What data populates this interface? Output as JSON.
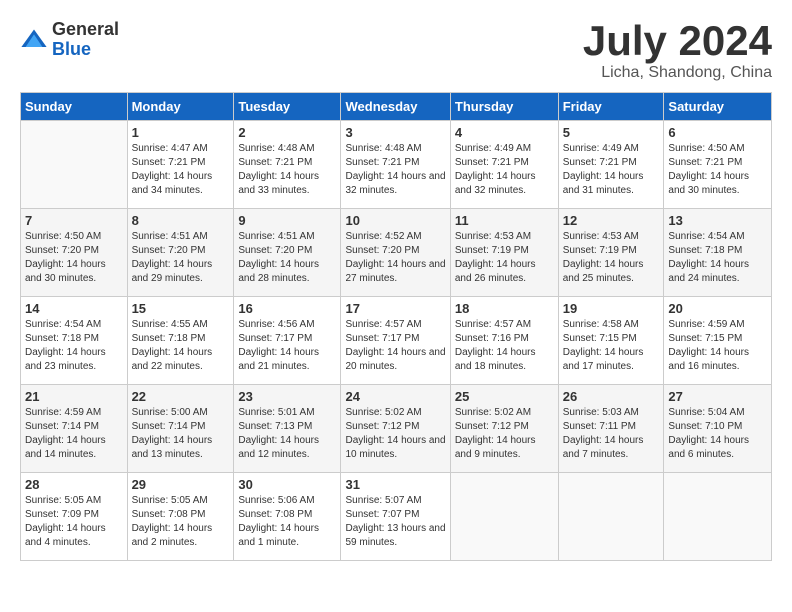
{
  "logo": {
    "general": "General",
    "blue": "Blue"
  },
  "title": "July 2024",
  "subtitle": "Licha, Shandong, China",
  "headers": [
    "Sunday",
    "Monday",
    "Tuesday",
    "Wednesday",
    "Thursday",
    "Friday",
    "Saturday"
  ],
  "weeks": [
    [
      {
        "day": "",
        "sunrise": "",
        "sunset": "",
        "daylight": ""
      },
      {
        "day": "1",
        "sunrise": "Sunrise: 4:47 AM",
        "sunset": "Sunset: 7:21 PM",
        "daylight": "Daylight: 14 hours and 34 minutes."
      },
      {
        "day": "2",
        "sunrise": "Sunrise: 4:48 AM",
        "sunset": "Sunset: 7:21 PM",
        "daylight": "Daylight: 14 hours and 33 minutes."
      },
      {
        "day": "3",
        "sunrise": "Sunrise: 4:48 AM",
        "sunset": "Sunset: 7:21 PM",
        "daylight": "Daylight: 14 hours and 32 minutes."
      },
      {
        "day": "4",
        "sunrise": "Sunrise: 4:49 AM",
        "sunset": "Sunset: 7:21 PM",
        "daylight": "Daylight: 14 hours and 32 minutes."
      },
      {
        "day": "5",
        "sunrise": "Sunrise: 4:49 AM",
        "sunset": "Sunset: 7:21 PM",
        "daylight": "Daylight: 14 hours and 31 minutes."
      },
      {
        "day": "6",
        "sunrise": "Sunrise: 4:50 AM",
        "sunset": "Sunset: 7:21 PM",
        "daylight": "Daylight: 14 hours and 30 minutes."
      }
    ],
    [
      {
        "day": "7",
        "sunrise": "Sunrise: 4:50 AM",
        "sunset": "Sunset: 7:20 PM",
        "daylight": "Daylight: 14 hours and 30 minutes."
      },
      {
        "day": "8",
        "sunrise": "Sunrise: 4:51 AM",
        "sunset": "Sunset: 7:20 PM",
        "daylight": "Daylight: 14 hours and 29 minutes."
      },
      {
        "day": "9",
        "sunrise": "Sunrise: 4:51 AM",
        "sunset": "Sunset: 7:20 PM",
        "daylight": "Daylight: 14 hours and 28 minutes."
      },
      {
        "day": "10",
        "sunrise": "Sunrise: 4:52 AM",
        "sunset": "Sunset: 7:20 PM",
        "daylight": "Daylight: 14 hours and 27 minutes."
      },
      {
        "day": "11",
        "sunrise": "Sunrise: 4:53 AM",
        "sunset": "Sunset: 7:19 PM",
        "daylight": "Daylight: 14 hours and 26 minutes."
      },
      {
        "day": "12",
        "sunrise": "Sunrise: 4:53 AM",
        "sunset": "Sunset: 7:19 PM",
        "daylight": "Daylight: 14 hours and 25 minutes."
      },
      {
        "day": "13",
        "sunrise": "Sunrise: 4:54 AM",
        "sunset": "Sunset: 7:18 PM",
        "daylight": "Daylight: 14 hours and 24 minutes."
      }
    ],
    [
      {
        "day": "14",
        "sunrise": "Sunrise: 4:54 AM",
        "sunset": "Sunset: 7:18 PM",
        "daylight": "Daylight: 14 hours and 23 minutes."
      },
      {
        "day": "15",
        "sunrise": "Sunrise: 4:55 AM",
        "sunset": "Sunset: 7:18 PM",
        "daylight": "Daylight: 14 hours and 22 minutes."
      },
      {
        "day": "16",
        "sunrise": "Sunrise: 4:56 AM",
        "sunset": "Sunset: 7:17 PM",
        "daylight": "Daylight: 14 hours and 21 minutes."
      },
      {
        "day": "17",
        "sunrise": "Sunrise: 4:57 AM",
        "sunset": "Sunset: 7:17 PM",
        "daylight": "Daylight: 14 hours and 20 minutes."
      },
      {
        "day": "18",
        "sunrise": "Sunrise: 4:57 AM",
        "sunset": "Sunset: 7:16 PM",
        "daylight": "Daylight: 14 hours and 18 minutes."
      },
      {
        "day": "19",
        "sunrise": "Sunrise: 4:58 AM",
        "sunset": "Sunset: 7:15 PM",
        "daylight": "Daylight: 14 hours and 17 minutes."
      },
      {
        "day": "20",
        "sunrise": "Sunrise: 4:59 AM",
        "sunset": "Sunset: 7:15 PM",
        "daylight": "Daylight: 14 hours and 16 minutes."
      }
    ],
    [
      {
        "day": "21",
        "sunrise": "Sunrise: 4:59 AM",
        "sunset": "Sunset: 7:14 PM",
        "daylight": "Daylight: 14 hours and 14 minutes."
      },
      {
        "day": "22",
        "sunrise": "Sunrise: 5:00 AM",
        "sunset": "Sunset: 7:14 PM",
        "daylight": "Daylight: 14 hours and 13 minutes."
      },
      {
        "day": "23",
        "sunrise": "Sunrise: 5:01 AM",
        "sunset": "Sunset: 7:13 PM",
        "daylight": "Daylight: 14 hours and 12 minutes."
      },
      {
        "day": "24",
        "sunrise": "Sunrise: 5:02 AM",
        "sunset": "Sunset: 7:12 PM",
        "daylight": "Daylight: 14 hours and 10 minutes."
      },
      {
        "day": "25",
        "sunrise": "Sunrise: 5:02 AM",
        "sunset": "Sunset: 7:12 PM",
        "daylight": "Daylight: 14 hours and 9 minutes."
      },
      {
        "day": "26",
        "sunrise": "Sunrise: 5:03 AM",
        "sunset": "Sunset: 7:11 PM",
        "daylight": "Daylight: 14 hours and 7 minutes."
      },
      {
        "day": "27",
        "sunrise": "Sunrise: 5:04 AM",
        "sunset": "Sunset: 7:10 PM",
        "daylight": "Daylight: 14 hours and 6 minutes."
      }
    ],
    [
      {
        "day": "28",
        "sunrise": "Sunrise: 5:05 AM",
        "sunset": "Sunset: 7:09 PM",
        "daylight": "Daylight: 14 hours and 4 minutes."
      },
      {
        "day": "29",
        "sunrise": "Sunrise: 5:05 AM",
        "sunset": "Sunset: 7:08 PM",
        "daylight": "Daylight: 14 hours and 2 minutes."
      },
      {
        "day": "30",
        "sunrise": "Sunrise: 5:06 AM",
        "sunset": "Sunset: 7:08 PM",
        "daylight": "Daylight: 14 hours and 1 minute."
      },
      {
        "day": "31",
        "sunrise": "Sunrise: 5:07 AM",
        "sunset": "Sunset: 7:07 PM",
        "daylight": "Daylight: 13 hours and 59 minutes."
      },
      {
        "day": "",
        "sunrise": "",
        "sunset": "",
        "daylight": ""
      },
      {
        "day": "",
        "sunrise": "",
        "sunset": "",
        "daylight": ""
      },
      {
        "day": "",
        "sunrise": "",
        "sunset": "",
        "daylight": ""
      }
    ]
  ]
}
